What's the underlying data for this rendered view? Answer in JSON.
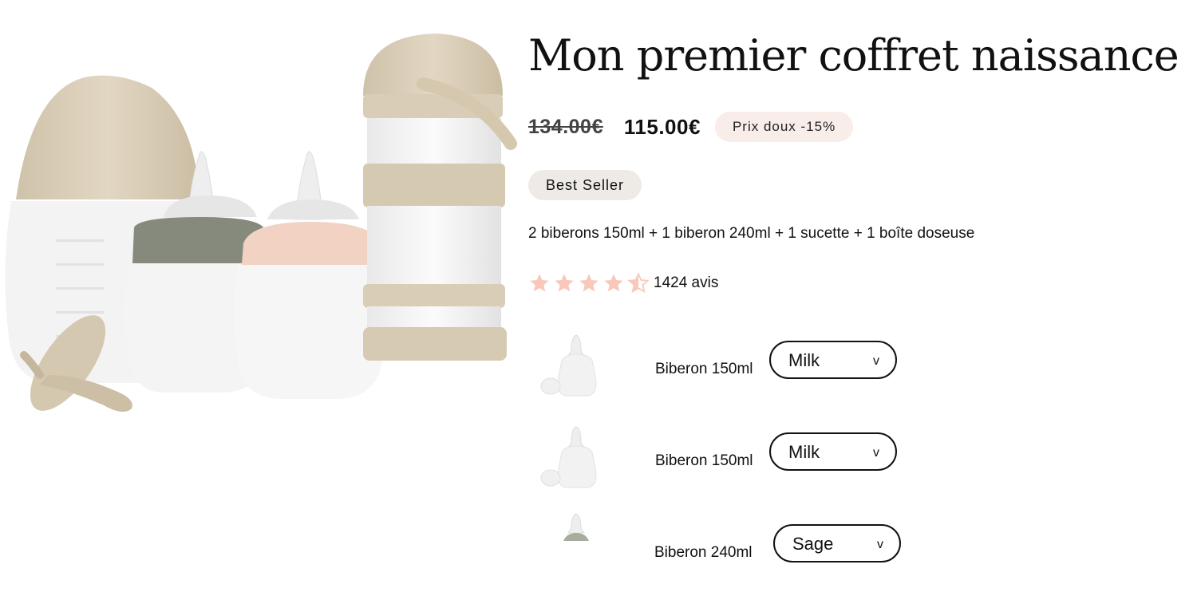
{
  "product": {
    "title": "Mon premier coffret naissance",
    "old_price": "134.00€",
    "new_price": "115.00€",
    "discount_badge": "Prix doux -15%",
    "best_seller_badge": "Best Seller",
    "description": "2 biberons 150ml + 1 biberon 240ml + 1 sucette + 1 boîte doseuse",
    "rating": {
      "stars_filled": 4.5,
      "stars_max": 5,
      "reviews_count": "1424 avis",
      "star_color": "#f9c8bb"
    }
  },
  "variants": [
    {
      "thumb_icon": "bottle-thumbnail-icon",
      "label": "Biberon 150ml",
      "selected": "Milk",
      "chevron": "v"
    },
    {
      "thumb_icon": "bottle-thumbnail-icon",
      "label": "Biberon 150ml",
      "selected": "Milk",
      "chevron": "v"
    },
    {
      "thumb_icon": "bottle-thumbnail-icon",
      "label": "Biberon 240ml",
      "selected": "Sage",
      "chevron": "v"
    }
  ],
  "colors": {
    "sand": "#d9cdb7",
    "sage": "#858a7c",
    "blush": "#f2d3c3",
    "badge_discount_bg": "#f8ede9",
    "badge_best_seller_bg": "#eeeae5"
  }
}
